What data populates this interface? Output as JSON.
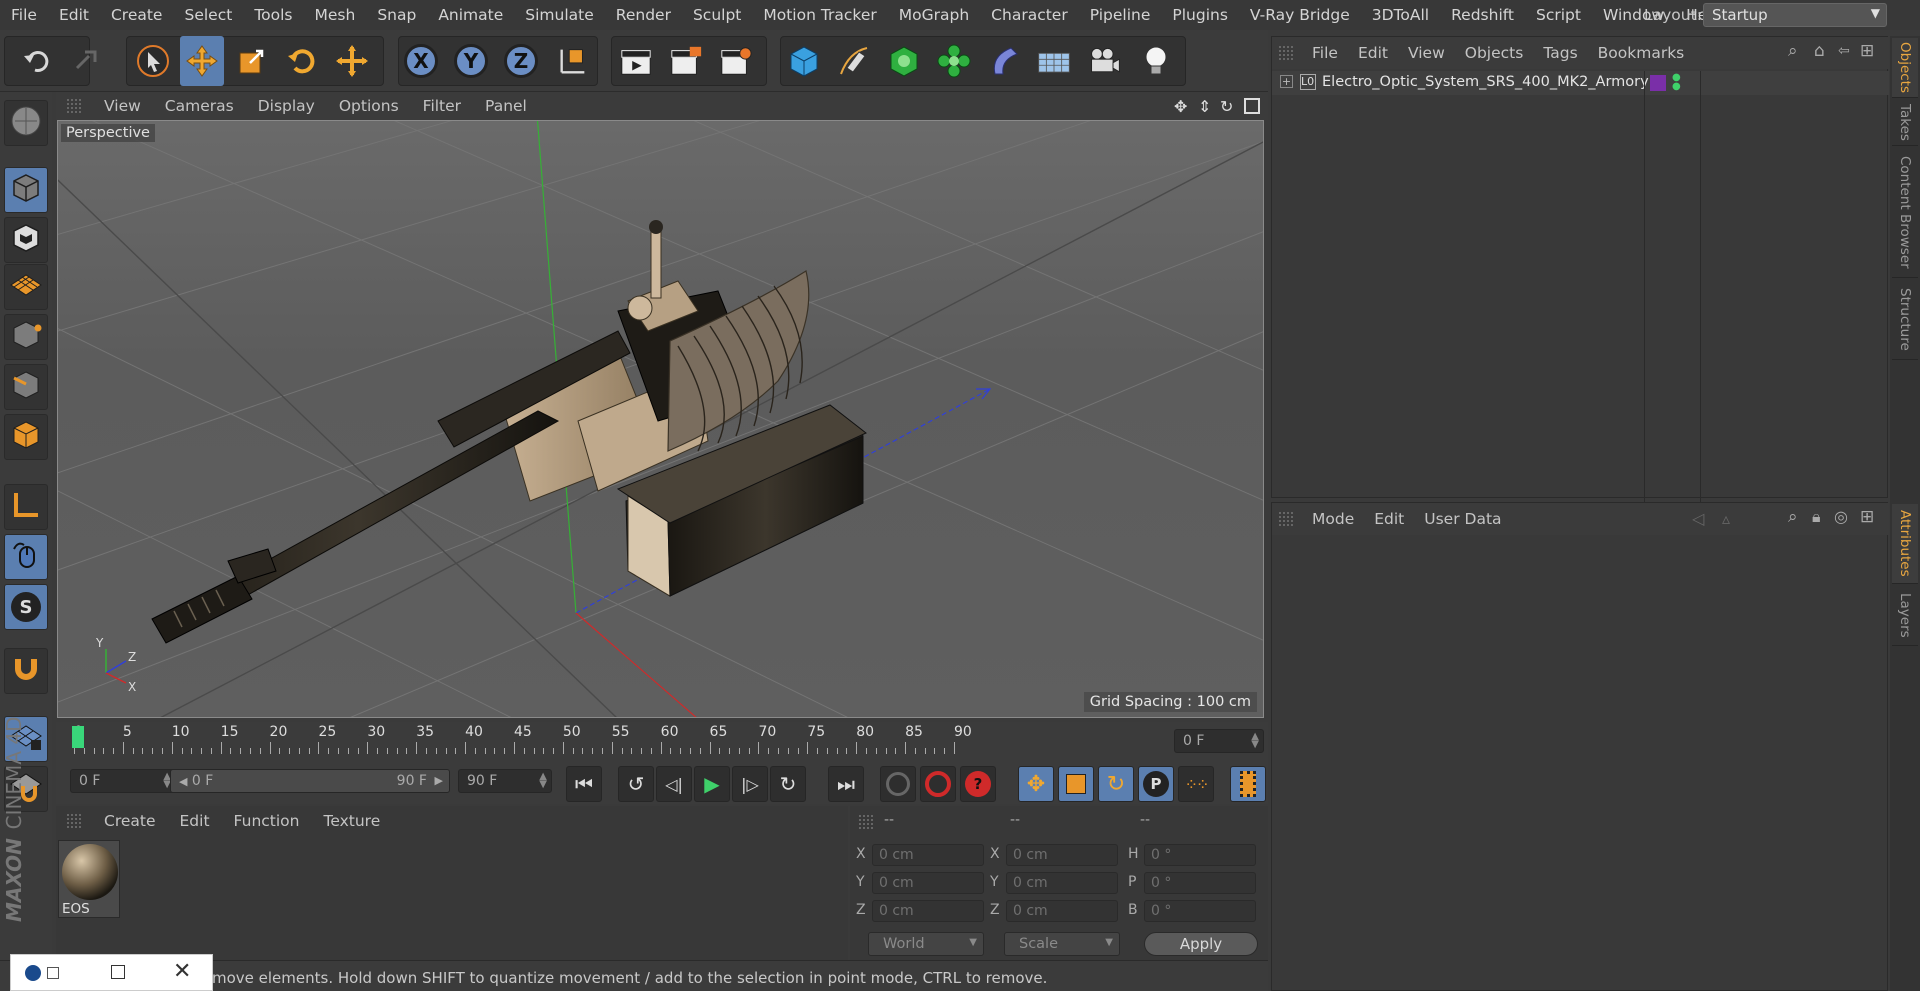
{
  "menubar": {
    "items": [
      "File",
      "Edit",
      "Create",
      "Select",
      "Tools",
      "Mesh",
      "Snap",
      "Animate",
      "Simulate",
      "Render",
      "Sculpt",
      "Motion Tracker",
      "MoGraph",
      "Character",
      "Pipeline",
      "Plugins",
      "V-Ray Bridge",
      "3DToAll",
      "Redshift",
      "Script",
      "Window",
      "Help"
    ],
    "layout_label": "Layout:",
    "layout_value": "Startup"
  },
  "toolbar": {
    "axis_x": "X",
    "axis_y": "Y",
    "axis_z": "Z"
  },
  "lefttools": {
    "snap_label": "S"
  },
  "brand": {
    "maxon": "MAXON",
    "product": "CINEMA 4D"
  },
  "viewport": {
    "menu": [
      "View",
      "Cameras",
      "Display",
      "Options",
      "Filter",
      "Panel"
    ],
    "label": "Perspective",
    "grid_spacing": "Grid Spacing : 100 cm",
    "axis_y": "Y",
    "axis_z": "Z",
    "axis_x": "X"
  },
  "timeline": {
    "ticks": [
      "0",
      "5",
      "10",
      "15",
      "20",
      "25",
      "30",
      "35",
      "40",
      "45",
      "50",
      "55",
      "60",
      "65",
      "70",
      "75",
      "80",
      "85",
      "90"
    ],
    "current_frame": "0 F"
  },
  "transport": {
    "start_field": "0 F",
    "range_start": "0 F",
    "range_end": "90 F",
    "end_field": "90 F",
    "key_p": "P"
  },
  "material_manager": {
    "menu": [
      "Create",
      "Edit",
      "Function",
      "Texture"
    ],
    "materials": [
      {
        "name": "EOS"
      }
    ]
  },
  "coordinates": {
    "headers": [
      "--",
      "--",
      "--"
    ],
    "rows": [
      {
        "l1": "X",
        "v1": "0 cm",
        "l2": "X",
        "v2": "0 cm",
        "l3": "H",
        "v3": "0 °"
      },
      {
        "l1": "Y",
        "v1": "0 cm",
        "l2": "Y",
        "v2": "0 cm",
        "l3": "P",
        "v3": "0 °"
      },
      {
        "l1": "Z",
        "v1": "0 cm",
        "l2": "Z",
        "v2": "0 cm",
        "l3": "B",
        "v3": "0 °"
      }
    ],
    "space": "World",
    "mode": "Scale",
    "apply": "Apply"
  },
  "status": {
    "text": "move elements. Hold down SHIFT to quantize movement / add to the selection in point mode, CTRL to remove."
  },
  "object_manager": {
    "menu": [
      "File",
      "Edit",
      "View",
      "Objects",
      "Tags",
      "Bookmarks"
    ],
    "objects": [
      {
        "name": "Electro_Optic_System_SRS_400_MK2_Armory",
        "layer_color": "#7a2fa8"
      }
    ]
  },
  "attribute_manager": {
    "menu": [
      "Mode",
      "Edit",
      "User Data"
    ]
  },
  "right_tabs": [
    "Objects",
    "Takes",
    "Content Browser",
    "Structure",
    "Attributes",
    "Layers"
  ],
  "colors": {
    "accent_blue": "#5b7fb0",
    "accent_orange": "#e8a640",
    "background": "#3a3a3a"
  }
}
